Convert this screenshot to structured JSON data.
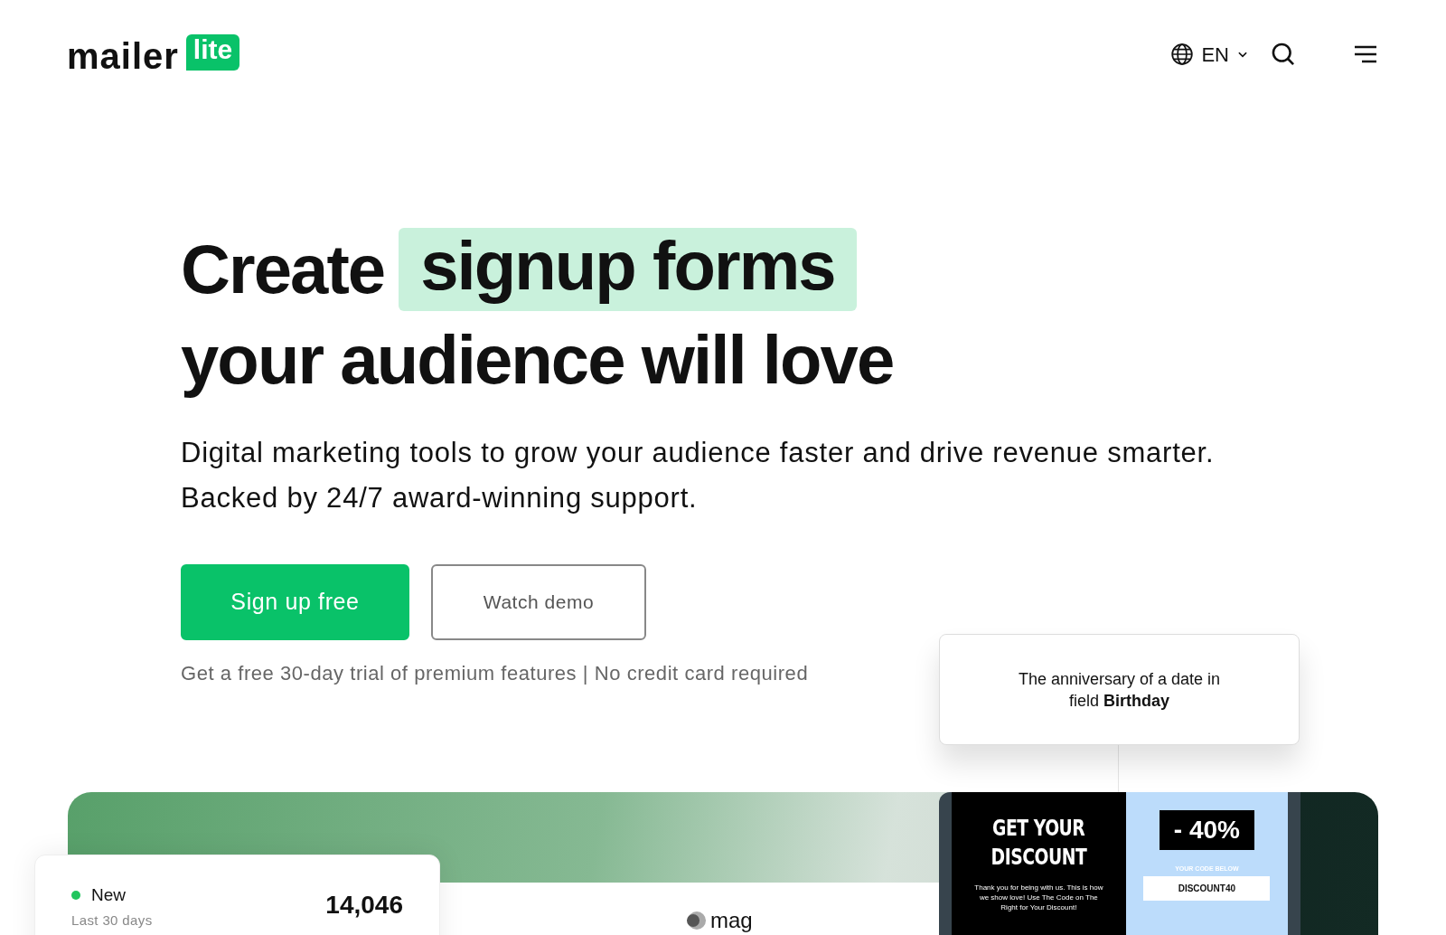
{
  "header": {
    "logo_word": "mailer",
    "logo_badge": "lite",
    "language": "EN"
  },
  "hero": {
    "title_start": "Create",
    "title_highlight": "signup forms",
    "title_end": "your audience will love",
    "subtitle_lines": [
      "Digital marketing tools to grow your audience faster and drive revenue smarter.",
      "Backed by 24/7 award-winning support."
    ],
    "buttons": [
      {
        "kind": "primary",
        "label": "Sign up free"
      },
      {
        "kind": "outline",
        "label": "Watch demo"
      }
    ],
    "note": "Get a free 30-day trial of premium features | No credit card required"
  },
  "automation_card": {
    "text": "The anniversary of a date in field **Birthday**"
  },
  "stat_card": {
    "label": "New",
    "color": "#22c55e",
    "period": "Last 30 days",
    "value": "14,046"
  },
  "preview_logo": "mag",
  "email_preview": {
    "headline_lines": [
      "GET YOUR",
      "DISCOUNT"
    ],
    "body": "Thank you for being with us. This is how we show love! Use The Code on The Right for Your Discount!",
    "discount": "- 40%",
    "code_label": "YOUR CODE BELOW",
    "code": "DISCOUNT40"
  }
}
